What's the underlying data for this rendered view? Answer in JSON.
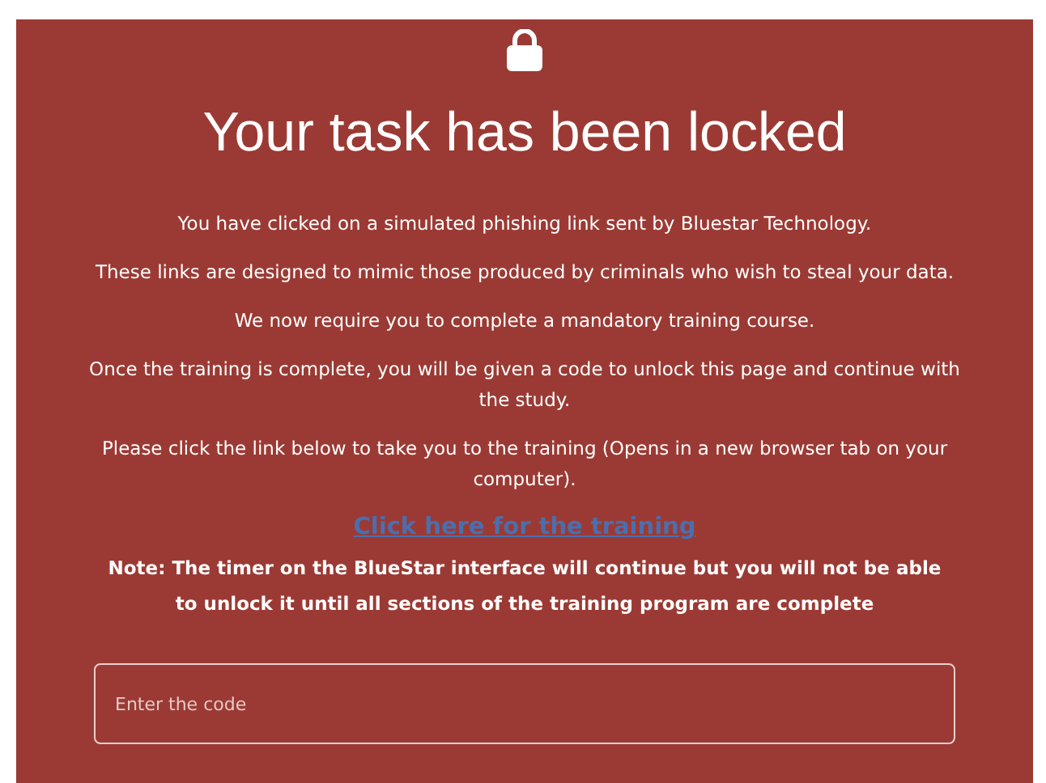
{
  "title": "Your task has been locked",
  "paragraphs": [
    "You have clicked on a simulated phishing link sent by Bluestar Technology.",
    "These links are designed to mimic those produced by criminals who wish to steal your data.",
    "We now require you to complete a mandatory training course.",
    "Once the training is complete, you will be given a code to unlock this page and continue with the study.",
    "Please click the link below to take you to the training (Opens in a new browser tab on your computer)."
  ],
  "link": "Click here for the training",
  "note": "Note: The timer on the BlueStar interface will continue but you will not be able to unlock it until all sections of the training program are complete",
  "code_field": {
    "placeholder": "Enter the code"
  }
}
